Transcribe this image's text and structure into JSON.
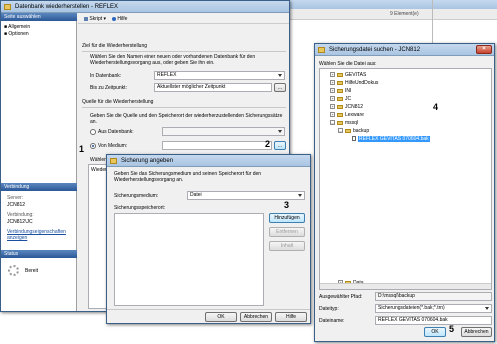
{
  "background_window": {
    "status": "9 Element(e)"
  },
  "restore_dialog": {
    "title": "Datenbank wiederherstellen - REFLEX",
    "sidebar_header": "Seite auswählen",
    "pages": [
      "Allgemein",
      "Optionen"
    ],
    "connection_header": "Verbindung",
    "server_label": "Server:",
    "server_value": "JCN812",
    "connection_label": "Verbindung:",
    "connection_value": "JCN812\\JC",
    "connection_properties_link": "Verbindungseigenschaften anzeigen",
    "status_header": "Status",
    "status_value": "Bereit",
    "toolbar_script": "Skript",
    "toolbar_help": "Hilfe",
    "target_group": "Ziel für die Wiederherstellung",
    "target_desc": "Wählen Sie den Namen einer neuen oder vorhandenen Datenbank für den Wiederherstellungsvorgang aus, oder geben Sie ihn ein.",
    "to_database_label": "In Datenbank:",
    "to_database_value": "REFLEX",
    "to_point_label": "Bis zu Zeitpunkt:",
    "to_point_value": "Aktuellster möglicher Zeitpunkt",
    "source_group": "Quelle für die Wiederherstellung",
    "source_desc": "Geben Sie die Quelle und den Speicherort der wiederherzustellenden Sicherungssätze an.",
    "from_database_label": "Aus Datenbank:",
    "from_device_label": "Von Medium:",
    "choose_label": "Wählen",
    "restore_label": "Wieder"
  },
  "backup_dialog": {
    "title": "Sicherung angeben",
    "desc": "Geben Sie das Sicherungsmedium und seinen Speicherort für den Wiederherstellungsvorgang an.",
    "medium_label": "Sicherungsmedium:",
    "medium_value": "Datei",
    "location_label": "Sicherungsspeicherort:",
    "add_button": "Hinzufügen",
    "remove_button": "Entfernen",
    "contents_button": "Inhalt",
    "ok_button": "OK",
    "cancel_button": "Abbrechen",
    "help_button": "Hilfe"
  },
  "file_dialog": {
    "title": "Sicherungsdatei suchen - JCN812",
    "prompt": "Wählen Sie die Datei aus:",
    "tree": [
      "GEVITAS",
      "HilfeUndDokus",
      "INI",
      "JC",
      "JCN812",
      "Lexware"
    ],
    "mssql": "mssql",
    "backup": "backup",
    "selected_file": "REFLEX GEVITAS 070604.bak",
    "data_folder": "Data",
    "selected_path_label": "Ausgewählter Pfad:",
    "selected_path_value": "D:\\mssql\\backup",
    "filetype_label": "Dateityp:",
    "filetype_value": "Sicherungsdateien(*.bak;*.trn)",
    "filename_label": "Dateiname:",
    "filename_value": "REFLEX GEVITAS 070604.bak",
    "ok_button": "OK",
    "cancel_button": "Abbrechen"
  },
  "callouts": [
    "1",
    "2",
    "3",
    "4",
    "5"
  ]
}
